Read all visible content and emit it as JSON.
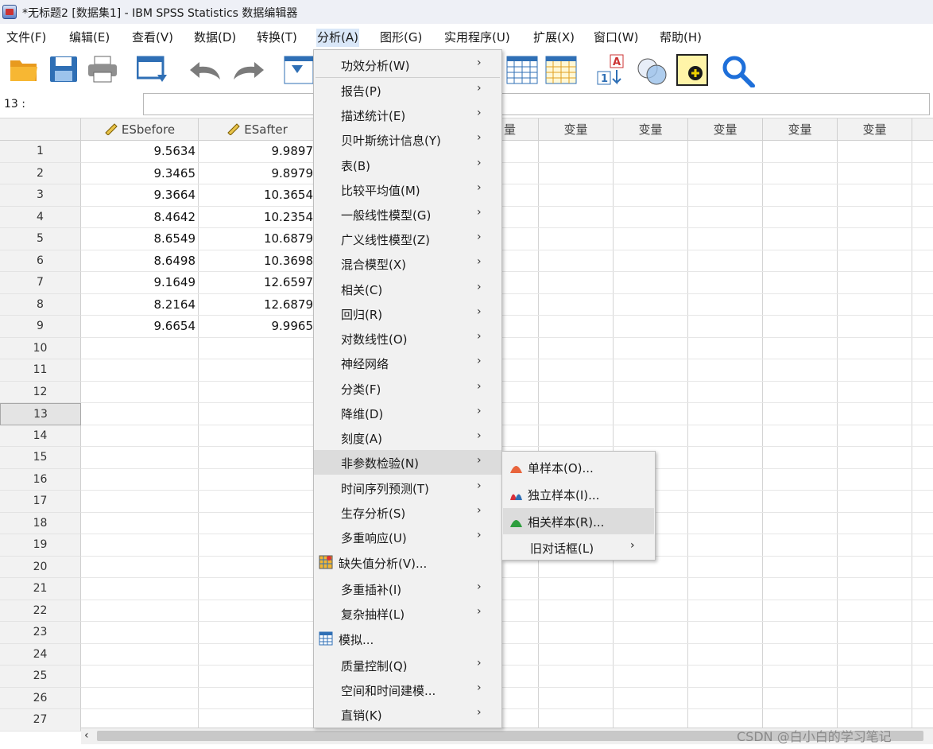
{
  "window": {
    "title": "*无标题2 [数据集1] - IBM SPSS Statistics 数据编辑器"
  },
  "menubar": [
    {
      "label": "文件(F)"
    },
    {
      "label": "编辑(E)"
    },
    {
      "label": "查看(V)"
    },
    {
      "label": "数据(D)"
    },
    {
      "label": "转换(T)"
    },
    {
      "label": "分析(A)"
    },
    {
      "label": "图形(G)"
    },
    {
      "label": "实用程序(U)"
    },
    {
      "label": "扩展(X)"
    },
    {
      "label": "窗口(W)"
    },
    {
      "label": "帮助(H)"
    }
  ],
  "cell_ref": "13 :",
  "cell_value": "",
  "columns": [
    "ESbefore",
    "ESafter",
    "变量",
    "变量",
    "变量",
    "变量",
    "变量",
    "变量"
  ],
  "partial_column": "量",
  "rows": [
    {
      "n": "1",
      "a": "9.5634",
      "b": "9.9897"
    },
    {
      "n": "2",
      "a": "9.3465",
      "b": "9.8979"
    },
    {
      "n": "3",
      "a": "9.3664",
      "b": "10.3654"
    },
    {
      "n": "4",
      "a": "8.4642",
      "b": "10.2354"
    },
    {
      "n": "5",
      "a": "8.6549",
      "b": "10.6879"
    },
    {
      "n": "6",
      "a": "8.6498",
      "b": "10.3698"
    },
    {
      "n": "7",
      "a": "9.1649",
      "b": "12.6597"
    },
    {
      "n": "8",
      "a": "8.2164",
      "b": "12.6879"
    },
    {
      "n": "9",
      "a": "9.6654",
      "b": "9.9965"
    }
  ],
  "empty_rows": [
    "10",
    "11",
    "12",
    "13",
    "14",
    "15",
    "16",
    "17",
    "18",
    "19",
    "20",
    "21",
    "22",
    "23",
    "24",
    "25",
    "26",
    "27"
  ],
  "selected_row": "13",
  "analyze_menu": [
    {
      "label": "功效分析(W)",
      "arrow": true
    },
    {
      "label": "报告(P)",
      "arrow": true
    },
    {
      "label": "描述统计(E)",
      "arrow": true
    },
    {
      "label": "贝叶斯统计信息(Y)",
      "arrow": true
    },
    {
      "label": "表(B)",
      "arrow": true
    },
    {
      "label": "比较平均值(M)",
      "arrow": true
    },
    {
      "label": "一般线性模型(G)",
      "arrow": true
    },
    {
      "label": "广义线性模型(Z)",
      "arrow": true
    },
    {
      "label": "混合模型(X)",
      "arrow": true
    },
    {
      "label": "相关(C)",
      "arrow": true
    },
    {
      "label": "回归(R)",
      "arrow": true
    },
    {
      "label": "对数线性(O)",
      "arrow": true
    },
    {
      "label": "神经网络",
      "arrow": true
    },
    {
      "label": "分类(F)",
      "arrow": true
    },
    {
      "label": "降维(D)",
      "arrow": true
    },
    {
      "label": "刻度(A)",
      "arrow": true
    },
    {
      "label": "非参数检验(N)",
      "arrow": true,
      "highlight": true
    },
    {
      "label": "时间序列预测(T)",
      "arrow": true
    },
    {
      "label": "生存分析(S)",
      "arrow": true
    },
    {
      "label": "多重响应(U)",
      "arrow": true
    },
    {
      "label": "缺失值分析(V)...",
      "arrow": false,
      "icon": "missing-value-icon"
    },
    {
      "label": "多重插补(I)",
      "arrow": true
    },
    {
      "label": "复杂抽样(L)",
      "arrow": true
    },
    {
      "label": "模拟...",
      "arrow": false,
      "icon": "simulation-icon"
    },
    {
      "label": "质量控制(Q)",
      "arrow": true
    },
    {
      "label": "空间和时间建模...",
      "arrow": true
    },
    {
      "label": "直销(K)",
      "arrow": true
    }
  ],
  "nonparam_submenu": [
    {
      "label": "单样本(O)...",
      "icon": "one-sample-icon",
      "color": "#e8643c"
    },
    {
      "label": "独立样本(I)...",
      "icon": "independent-samples-icon",
      "color": "#d8303a"
    },
    {
      "label": "相关样本(R)...",
      "icon": "related-samples-icon",
      "color": "#2e9e3e",
      "highlight": true
    },
    {
      "label": "旧对话框(L)",
      "arrow": true
    }
  ],
  "watermark": "CSDN @白小白的学习笔记",
  "colors": {
    "accent": "#1e6fd9",
    "menu_bg": "#f1f1f1",
    "highlight": "#dcdcdc",
    "menubar_active": "#d9e7f8"
  }
}
